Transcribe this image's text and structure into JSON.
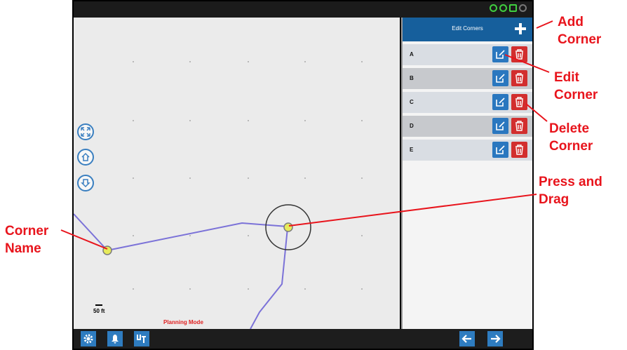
{
  "panel": {
    "title": "Edit Corners",
    "corners": [
      {
        "label": "A"
      },
      {
        "label": "B"
      },
      {
        "label": "C"
      },
      {
        "label": "D"
      },
      {
        "label": "E"
      }
    ]
  },
  "map": {
    "scale_label": "50 ft",
    "mode_label": "Planning Mode"
  },
  "annotations": {
    "add_corner": "Add\nCorner",
    "edit_corner": "Edit\nCorner",
    "delete_corner": "Delete\nCorner",
    "press_drag": "Press and\nDrag",
    "corner_name": "Corner\nName"
  },
  "colors": {
    "accent": "#165f9c",
    "edit": "#2a77bf",
    "delete": "#d22e2e",
    "annotation": "#e8141c",
    "path": "#7b72d8"
  },
  "icons": {
    "status": [
      "gps-icon",
      "signal-icon",
      "battery-icon",
      "tool-icon"
    ],
    "map_controls": [
      "fit-extents-icon",
      "home-icon",
      "download-icon"
    ],
    "bottom_left": [
      "gear-icon",
      "bell-icon",
      "ut-icon"
    ],
    "bottom_right": [
      "arrow-left-icon",
      "arrow-right-icon"
    ]
  }
}
